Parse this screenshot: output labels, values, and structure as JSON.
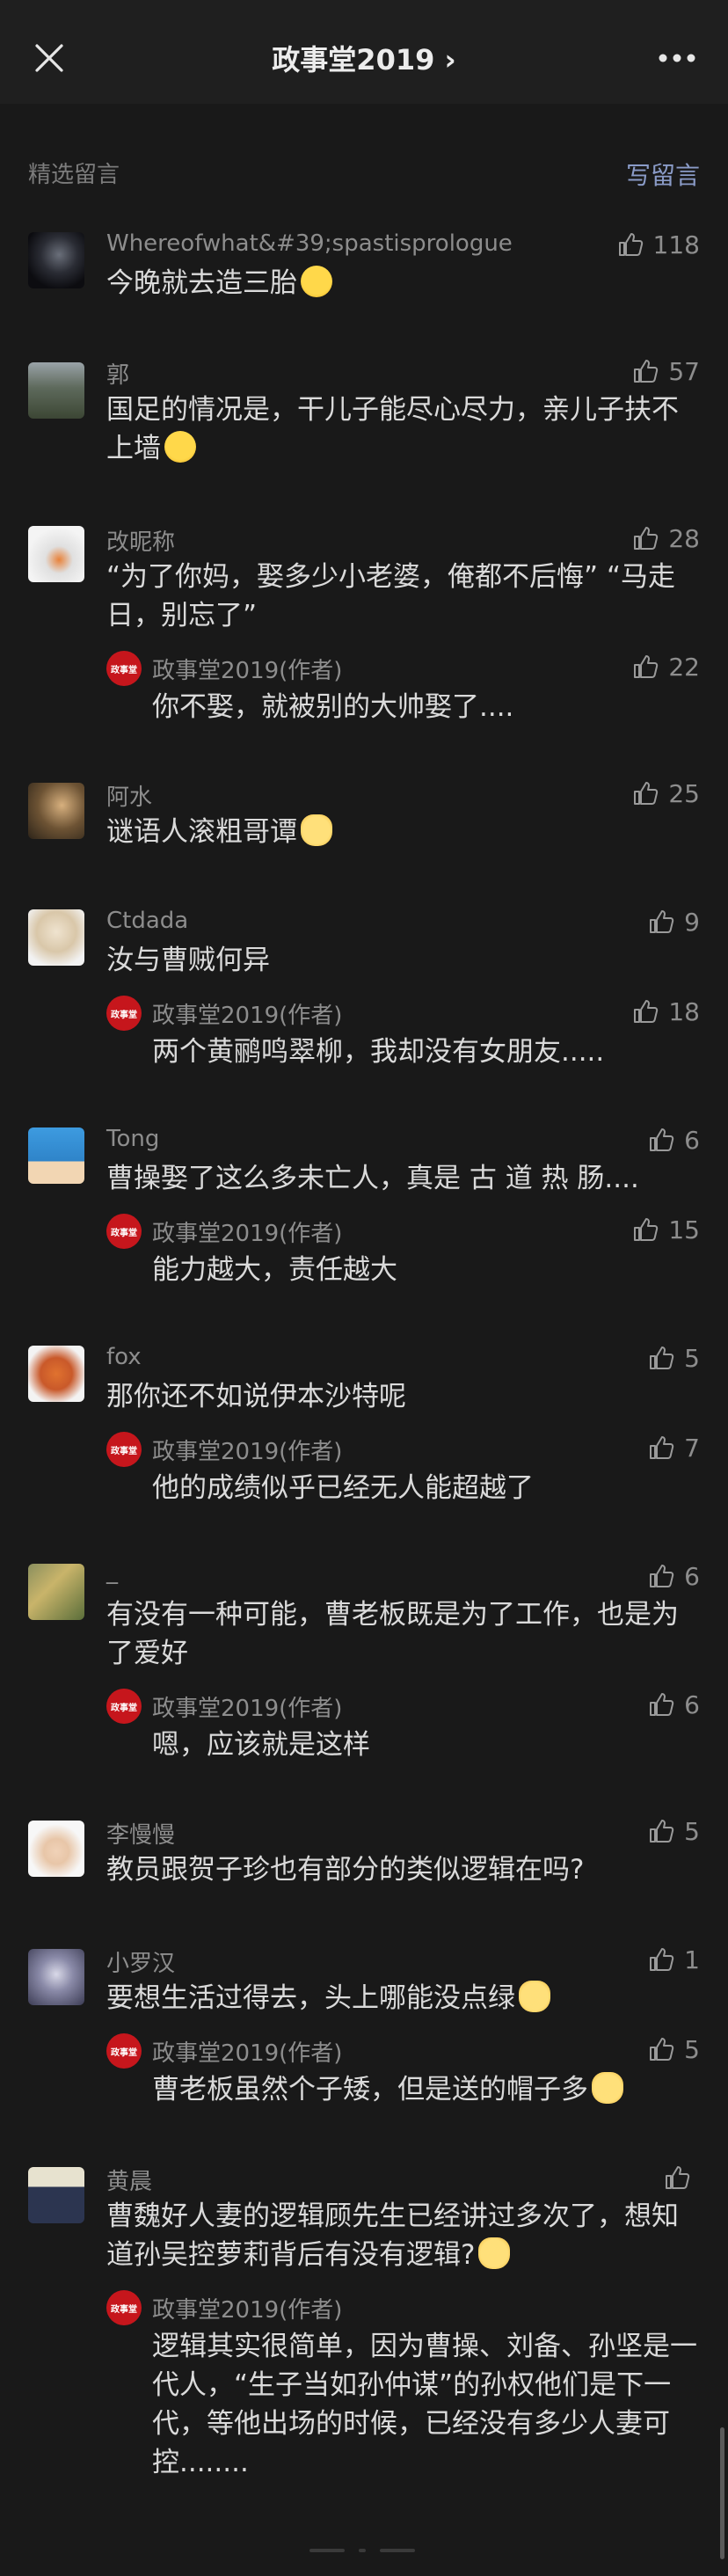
{
  "header": {
    "title": "政事堂2019 ›",
    "close_icon": "close-icon",
    "more_icon": "more-dots-icon"
  },
  "section": {
    "label": "精选留言",
    "write_label": "写留言"
  },
  "colors": {
    "background": "#191919",
    "accent_link": "#8a9bc7",
    "author_avatar": "#c6161c"
  },
  "author_avatar_text": "政事堂",
  "comments": [
    {
      "name": "Whereofwhat&#39;spastisprologue",
      "likes": "118",
      "text": "今晚就去造三胎",
      "emoji": "laugh-emoji"
    },
    {
      "name": "郭",
      "likes": "57",
      "text": "国足的情况是，干儿子能尽心尽力，亲儿子扶不上墙",
      "emoji": "laugh-emoji"
    },
    {
      "name": "改昵称",
      "likes": "28",
      "text": "“为了你妈，娶多少小老婆，俺都不后悔” “马走日，别忘了”",
      "reply": {
        "name": "政事堂2019(作者)",
        "likes": "22",
        "text": "你不娶，就被别的大帅娶了...."
      }
    },
    {
      "name": "阿水",
      "likes": "25",
      "text": "谜语人滚粗哥谭",
      "emoji": "cat-emoji"
    },
    {
      "name": "Ctdada",
      "likes": "9",
      "text": "汝与曹贼何异",
      "reply": {
        "name": "政事堂2019(作者)",
        "likes": "18",
        "text": "两个黄鹂鸣翠柳，我却没有女朋友....."
      }
    },
    {
      "name": "Tong",
      "likes": "6",
      "text": "曹操娶了这么多未亡人，真是 古 道 热 肠....",
      "reply": {
        "name": "政事堂2019(作者)",
        "likes": "15",
        "text": "能力越大，责任越大"
      }
    },
    {
      "name": "fox",
      "likes": "5",
      "text": "那你还不如说伊本沙特呢",
      "reply": {
        "name": "政事堂2019(作者)",
        "likes": "7",
        "text": "他的成绩似乎已经无人能超越了"
      }
    },
    {
      "name": "_",
      "likes": "6",
      "text": "有没有一种可能，曹老板既是为了工作，也是为了爱好",
      "reply": {
        "name": "政事堂2019(作者)",
        "likes": "6",
        "text": "嗯，应该就是这样"
      }
    },
    {
      "name": "李慢慢",
      "likes": "5",
      "text": "教员跟贺子珍也有部分的类似逻辑在吗?"
    },
    {
      "name": "小罗汉",
      "likes": "1",
      "text": "要想生活过得去，头上哪能没点绿",
      "emoji": "cat-emoji",
      "reply": {
        "name": "政事堂2019(作者)",
        "likes": "5",
        "text": "曹老板虽然个子矮，但是送的帽子多",
        "emoji": "cat-emoji"
      }
    },
    {
      "name": "黄晨",
      "likes": "",
      "text": "曹魏好人妻的逻辑顾先生已经讲过多次了，想知道孙吴控萝莉背后有没有逻辑?",
      "emoji": "cat-emoji",
      "reply": {
        "name": "政事堂2019(作者)",
        "likes": "",
        "text": "逻辑其实很简单，因为曹操、刘备、孙坚是一代人，“生子当如孙仲谋”的孙权他们是下一代，等他出场的时候，已经没有多少人妻可控........"
      }
    }
  ]
}
